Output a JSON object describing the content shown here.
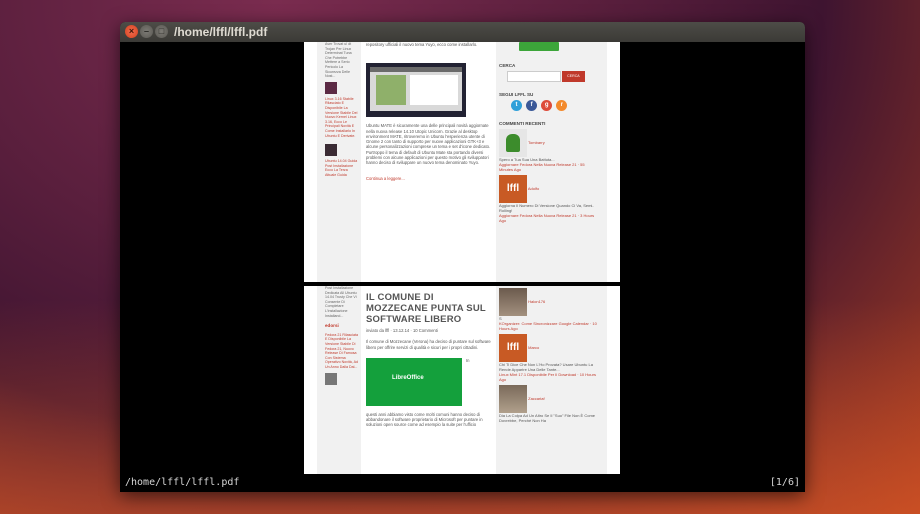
{
  "window": {
    "title": "/home/lffl/lffl.pdf",
    "close_glyph": "×",
    "min_glyph": "–",
    "max_glyph": "□"
  },
  "statusbar": {
    "path": "/home/lffl/lffl.pdf",
    "page_indicator": "[1/6]"
  },
  "page1": {
    "left_top": "Aver Trovat ul dt Trojan Per Linux Determinat Tuna Che Potrebbe Mettere a Serio Pericolo La Sicurezza Delle Nost...",
    "left_post1": "Linux 3.16 Stabile Rilasciato E Disponibile La Versione Stabile Del Nuovo Kernel Linux 3.16, Ecco Le Principali Novità E Come Installarlo In Ubuntu E Derivate.",
    "left_post2": "Ubuntu 14.04 Guida Post Installazione Ecco La Terza Attuale Guida",
    "main_top": "repository ufficiali il nuovo tema Yuyo, ecco come installarlo.",
    "main_body": "Ubuntu MATE è sicuramente una delle principali novità aggiornate nella nuova release 14.10 Utopic Unicorn. Grazie al desktop environment MATE, ritroveremo in Ubuntu l'esperienza utente di Gnome 2 con tanto di supporto per nuove applicazioni GTK+3 e alcune personalizzazioni comprese un tema e set d'icone dedicato. Purtroppo il tema di default di Ubuntu Mate sta portando diversi problemi con alcune applicazioni per questo motivo gli sviluppatori hanno deciso di sviluppare un nuovo tema denominato Yuyo.",
    "continue": "Continua a leggere...",
    "search_title": "CERCA",
    "search_button": "CERCA",
    "follow_title": "SEGUI LFFL SU",
    "comments_title": "COMMENTI RECENTI",
    "c1_author": "Tombarry",
    "c1_text": "Spero a Tua Sua Una Battuta...",
    "c1_link": "Aggiornare Fedora Nella Nuova Release 21 · 55 Minutes Ago",
    "c2_author": "Adolfo",
    "c2_text": "Aggiorna Il Numero Di Versione Quando Ci Va, Semi-Rolling!",
    "c2_link": "Aggiornare Fedora Nella Nuova Release 21 · 3 Hours Ago",
    "logo_text": "lffl"
  },
  "page2": {
    "left_top": "Post Installazione Dedicata All Ubuntu 14.04 Trusty Che Vi Consente Di Completare L'installazione Installand...",
    "left_section": "edorsi",
    "left_post": "Fedora 21 Rilasciata E Disponibile La Versione Stabile Di Fedora 21, Nuovo Release Di Famosa Con Sistema Operativo Novità, Ad Un Anno Dalla Dal...",
    "headline": "IL COMUNE DI MOZZECANE PUNTA SUL SOFTWARE LIBERO",
    "meta": "inviato da lffl · 13.12.14 · 10 Commenti",
    "intro": "Il comune di Mozzecane (Verona) ha deciso di puntare sul software libero per offrire servizi di qualità e sicuri per i propri cittadini.",
    "lo_label": "LibreOffice",
    "in_label": "In",
    "body": "questi anni abbiamo visto come molti comuni hanno deciso di abbandonare il software proprietario di Microsoft per puntare in soluzioni open source come ad esempio la suite per l'ufficio",
    "c1_author": "Halon176",
    "c1_text": "S",
    "c1_link": "KOrganizer: Come Sincronizzare Google Calendar · 10 Hours Ago",
    "c2_author": "Marco",
    "c2_text": "Chi Ti Dice Che Non L'Ho Provata? Usare Ubuntu La Rende Apparire Una Delle Tante...",
    "c2_link": "Linux Mint 17.1 Disponibile Per Il Download · 10 Hours Ago",
    "c3_author": "Zaccariaf",
    "c3_text": "Dia La Colpa Ad Un Altro Se Il \"Suo\" File Non È Come Dovrebbe, Perché Non Ha",
    "logo_text": "lffl"
  },
  "colors": {
    "accent": "#c0392b",
    "titlebar": "#3b3a36",
    "twitter": "#2fa0d9",
    "facebook": "#3b5998",
    "gplus": "#dd4b39",
    "rss": "#f38a2c",
    "green_button": "#3ca53a"
  }
}
